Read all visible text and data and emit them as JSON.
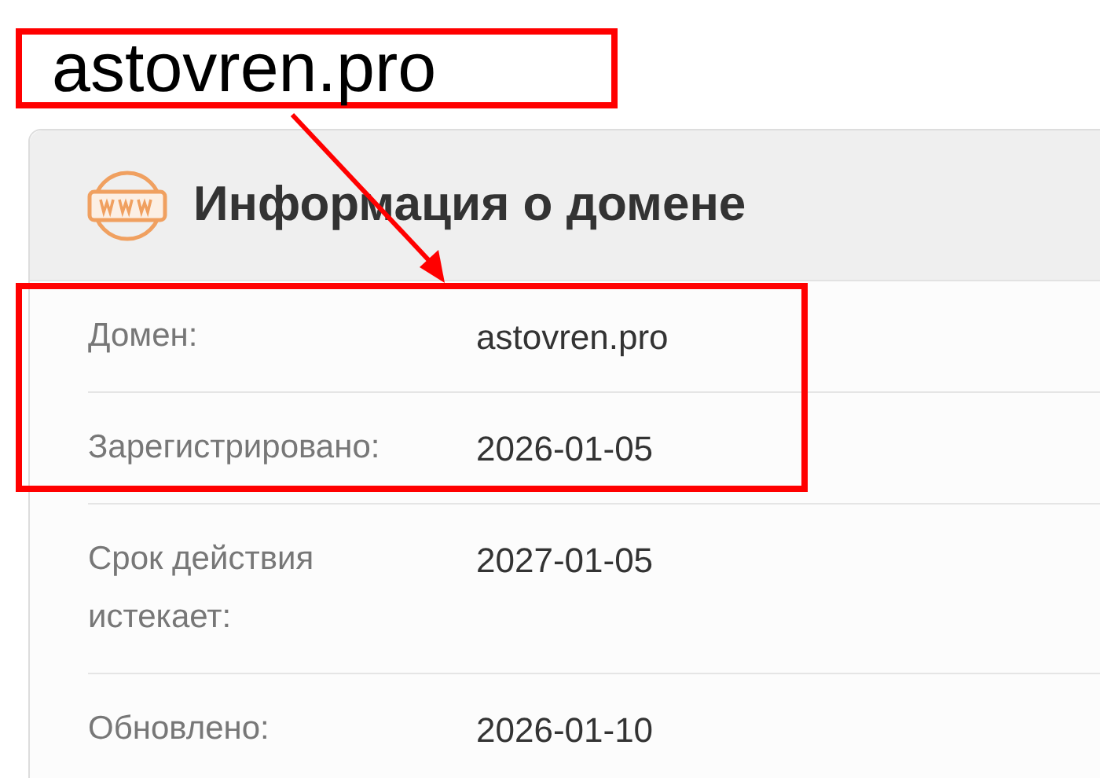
{
  "heading": "astovren.pro",
  "card": {
    "title": "Информация о домене",
    "rows": [
      {
        "label": "Домен:",
        "value": "astovren.pro"
      },
      {
        "label": "Зарегистрировано:",
        "value": "2026-01-05"
      },
      {
        "label": "Срок действия истекает:",
        "value": "2027-01-05"
      },
      {
        "label": "Обновлено:",
        "value": "2026-01-10"
      }
    ]
  }
}
